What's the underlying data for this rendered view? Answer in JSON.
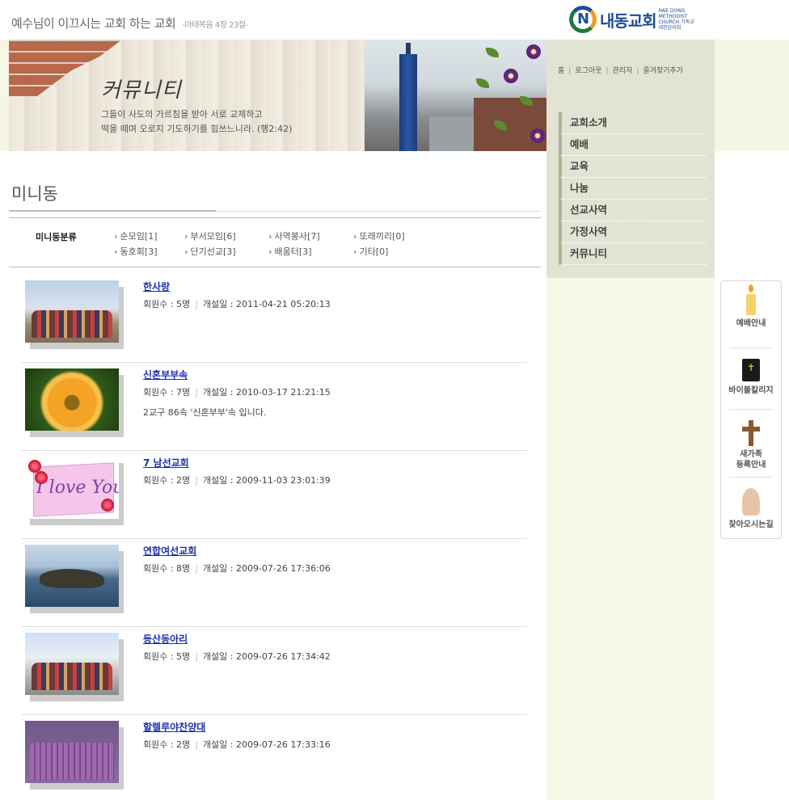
{
  "header": {
    "slogan": "예수님이 이끄시는 교회 하는 교회",
    "verse": "-마태복음 4장 23절-",
    "logo_text": "내동교회",
    "logo_sub": "NAE DONG METHODIST CHURCH 기독교대한감리회"
  },
  "banner": {
    "title": "커뮤니티",
    "desc_line1": "그들이 사도의 가르침을 받아 서로 교제하고",
    "desc_line2": "떡을 떼며 오로지 기도하기를 힘쓰느니라. (행2:42)"
  },
  "util_links": [
    "홈",
    "로그아웃",
    "관리자",
    "즐겨찾기추가"
  ],
  "side_menu": [
    "교회소개",
    "예배",
    "교육",
    "나눔",
    "선교사역",
    "가정사역",
    "커뮤니티"
  ],
  "quick_menu": {
    "worship": "예배안내",
    "bible": "바이블칼리지",
    "newfamily_1": "새가족",
    "newfamily_2": "등록안내",
    "directions": "찾아오시는길"
  },
  "page": {
    "title": "미니동"
  },
  "categories": {
    "label": "미니동분류",
    "items": [
      "순모임[1]",
      "부서모임[6]",
      "사역봉사[7]",
      "또래끼리[0]",
      "동호회[3]",
      "단기선교[3]",
      "배움터[3]",
      "기타[0]"
    ]
  },
  "entries": [
    {
      "title": "한사랑",
      "members": "회원수 : 5명",
      "date": "개설일 : 2011-04-21 05:20:13",
      "desc": ""
    },
    {
      "title": "신혼부부속",
      "members": "회원수 : 7명",
      "date": "개설일 : 2010-03-17 21:21:15",
      "desc": "2교구 86속 '신혼부부'속 입니다."
    },
    {
      "title": "7 남선교회",
      "members": "회원수 : 2명",
      "date": "개설일 : 2009-11-03 23:01:39",
      "desc": ""
    },
    {
      "title": "연합여선교회",
      "members": "회원수 : 8명",
      "date": "개설일 : 2009-07-26 17:36:06",
      "desc": ""
    },
    {
      "title": "등산동아리",
      "members": "회원수 : 5명",
      "date": "개설일 : 2009-07-26 17:34:42",
      "desc": ""
    },
    {
      "title": "할렐루야찬양대",
      "members": "회원수 : 2명",
      "date": "개설일 : 2009-07-26 17:33:16",
      "desc": ""
    }
  ],
  "thumb_text": {
    "love": "I love You"
  },
  "colors": {
    "link_blue": "#1a2fb0",
    "nav_panel": "#e2e3d3",
    "right_bg": "#f7f8e7",
    "menu_bar": "#a9b596"
  }
}
